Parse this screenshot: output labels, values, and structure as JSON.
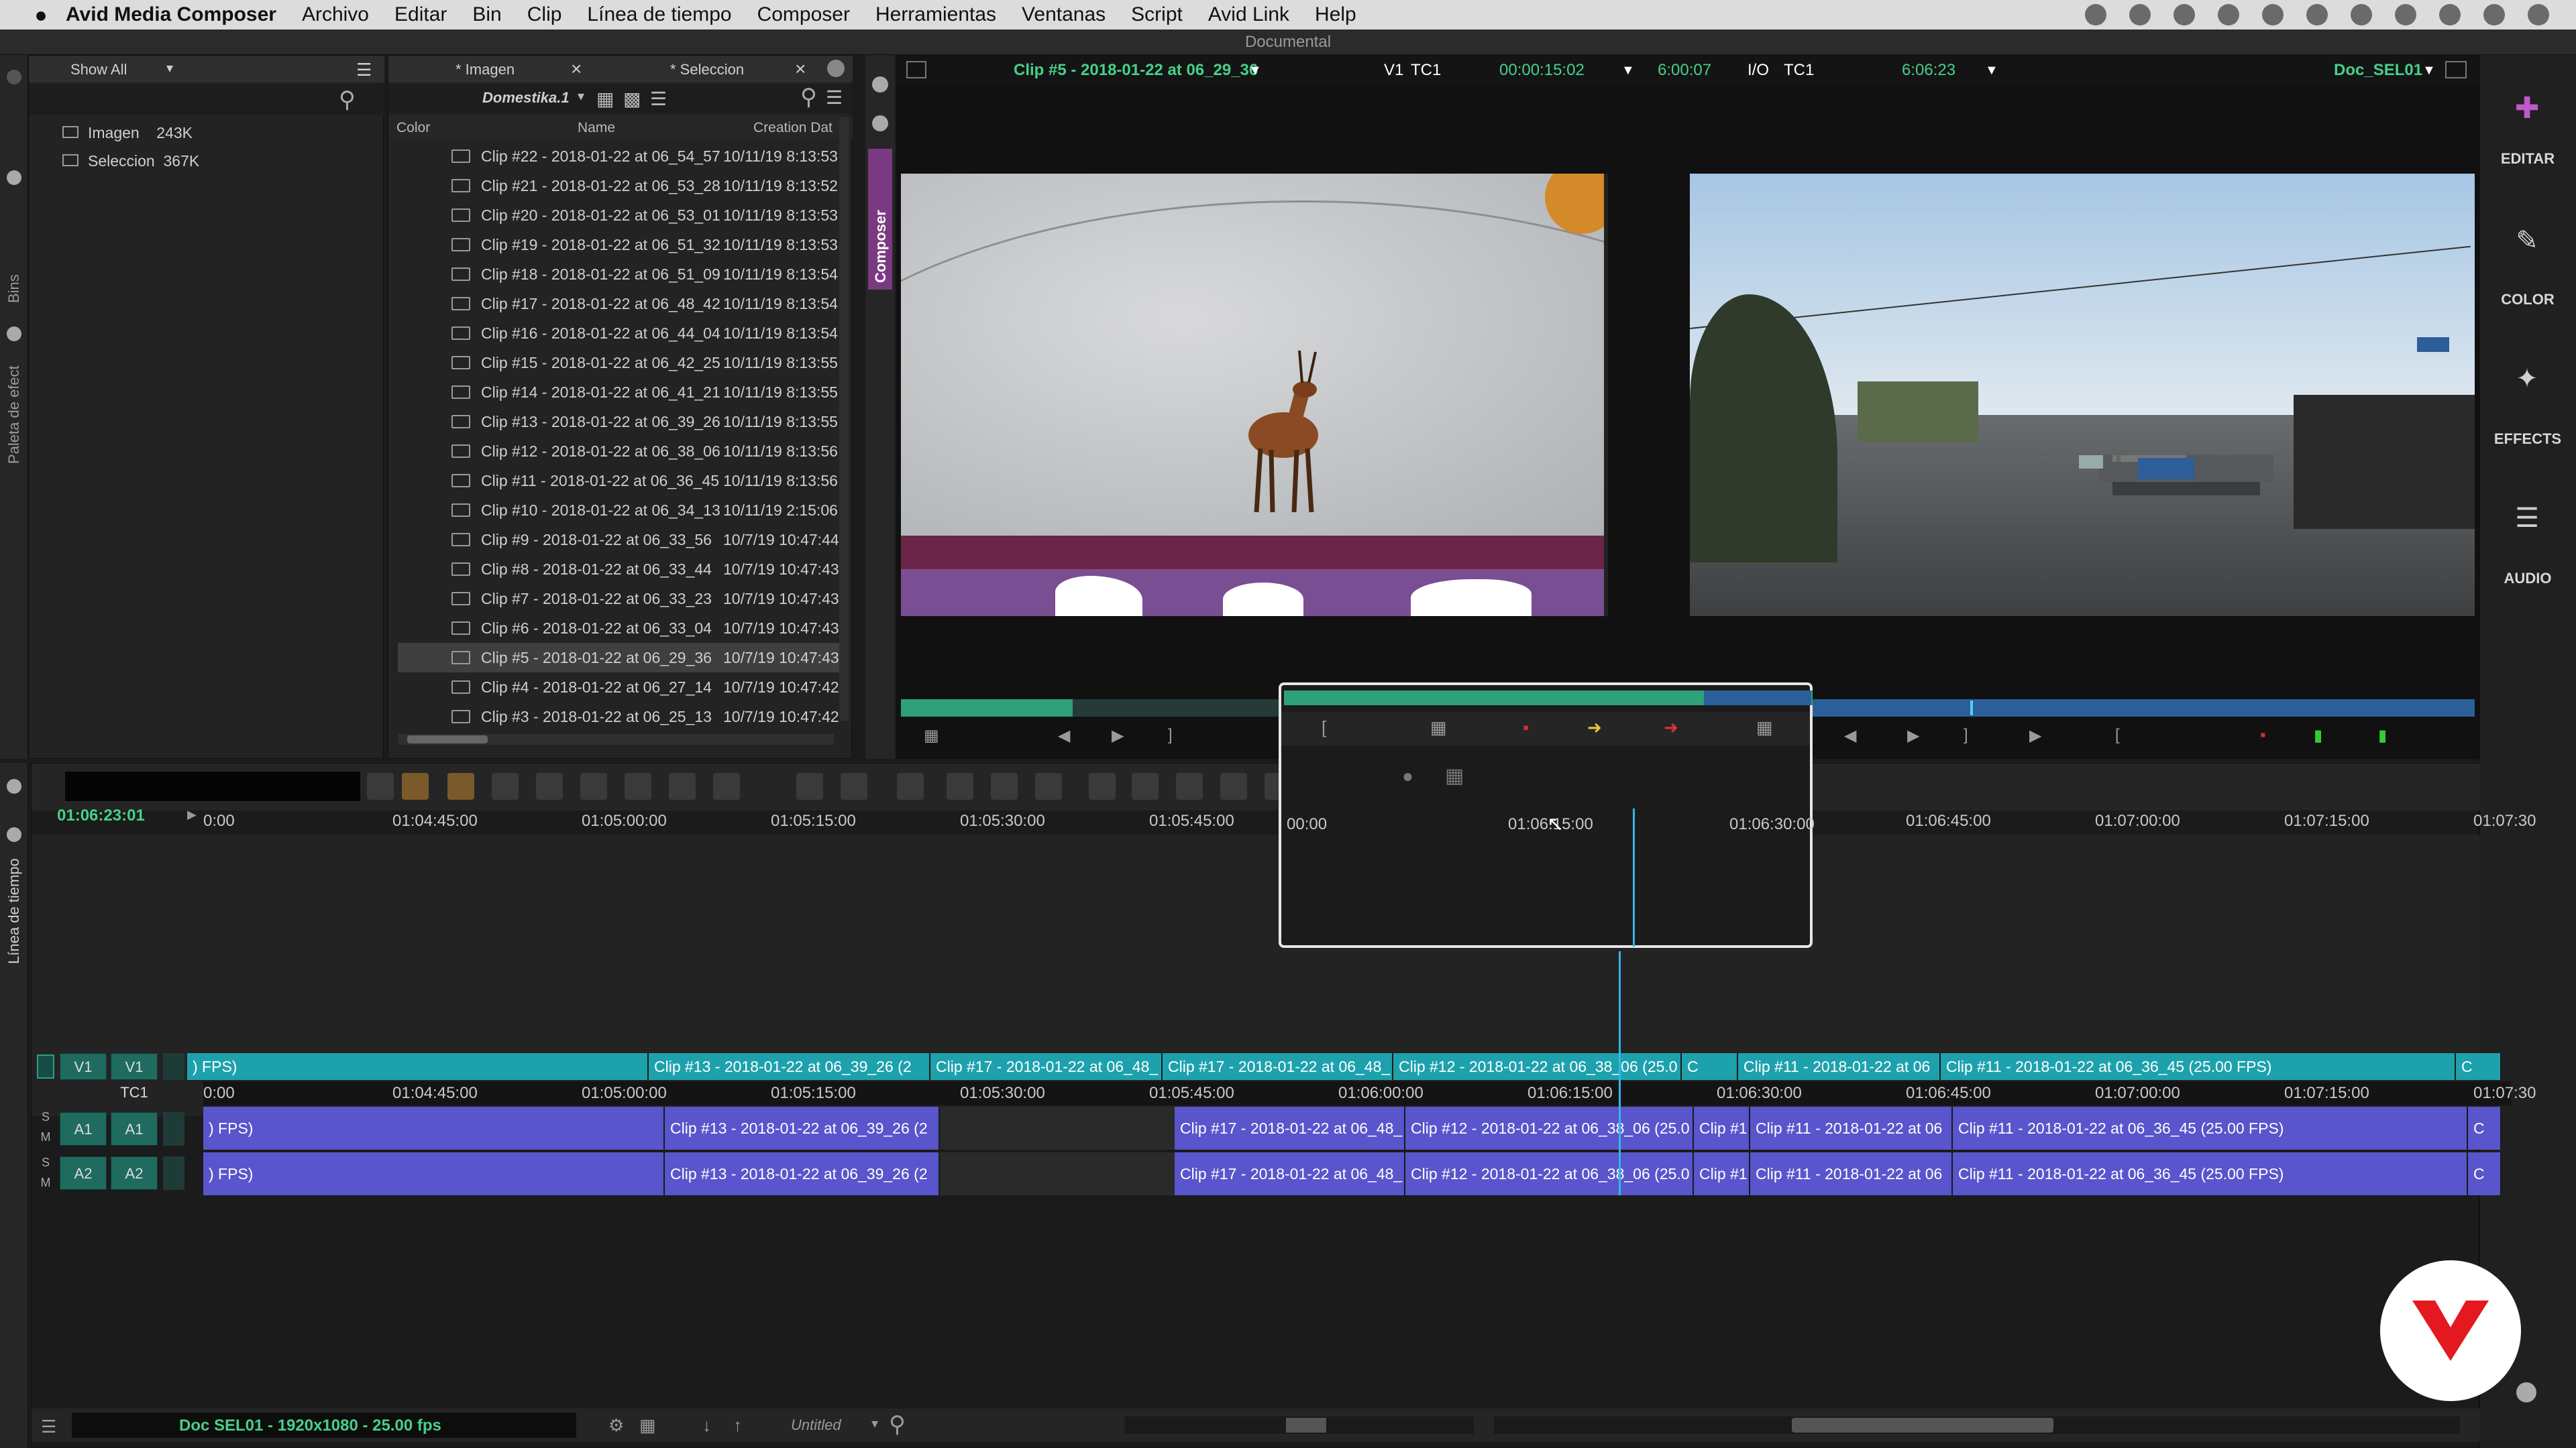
{
  "menubar": {
    "apple": "",
    "app": "Avid Media Composer",
    "items": [
      "Archivo",
      "Editar",
      "Bin",
      "Clip",
      "Línea de tiempo",
      "Composer",
      "Herramientas",
      "Ventanas",
      "Script",
      "Avid Link",
      "Help"
    ]
  },
  "window_title": "Documental",
  "bins_panel": {
    "filter": "Show All",
    "tab_label": "Bins",
    "effects_tab_label": "Paleta de efect",
    "bins": [
      {
        "name": "Imagen",
        "size": "243K"
      },
      {
        "name": "Seleccion",
        "size": "367K"
      }
    ]
  },
  "bin_tabs": {
    "tab1": "* Imagen",
    "tab2": "* Seleccion",
    "view": "Domestika.1",
    "columns": {
      "color": "Color",
      "name": "Name",
      "date": "Creation Dat"
    }
  },
  "clips": [
    {
      "name": "Clip #22 - 2018-01-22 at 06_54_57",
      "date": "10/11/19 8:13:53"
    },
    {
      "name": "Clip #21 - 2018-01-22 at 06_53_28",
      "date": "10/11/19 8:13:52"
    },
    {
      "name": "Clip #20 - 2018-01-22 at 06_53_01",
      "date": "10/11/19 8:13:53"
    },
    {
      "name": "Clip #19 - 2018-01-22 at 06_51_32",
      "date": "10/11/19 8:13:53"
    },
    {
      "name": "Clip #18 - 2018-01-22 at 06_51_09",
      "date": "10/11/19 8:13:54"
    },
    {
      "name": "Clip #17 - 2018-01-22 at 06_48_42",
      "date": "10/11/19 8:13:54"
    },
    {
      "name": "Clip #16 - 2018-01-22 at 06_44_04",
      "date": "10/11/19 8:13:54"
    },
    {
      "name": "Clip #15 - 2018-01-22 at 06_42_25",
      "date": "10/11/19 8:13:55"
    },
    {
      "name": "Clip #14 - 2018-01-22 at 06_41_21",
      "date": "10/11/19 8:13:55"
    },
    {
      "name": "Clip #13 - 2018-01-22 at 06_39_26",
      "date": "10/11/19 8:13:55"
    },
    {
      "name": "Clip #12 - 2018-01-22 at 06_38_06",
      "date": "10/11/19 8:13:56"
    },
    {
      "name": "Clip #11 - 2018-01-22 at 06_36_45",
      "date": "10/11/19 8:13:56"
    },
    {
      "name": "Clip #10 - 2018-01-22 at 06_34_13",
      "date": "10/11/19 2:15:06"
    },
    {
      "name": "Clip #9 - 2018-01-22 at 06_33_56",
      "date": "10/7/19 10:47:44"
    },
    {
      "name": "Clip #8 - 2018-01-22 at 06_33_44",
      "date": "10/7/19 10:47:43"
    },
    {
      "name": "Clip #7 - 2018-01-22 at 06_33_23",
      "date": "10/7/19 10:47:43"
    },
    {
      "name": "Clip #6 - 2018-01-22 at 06_33_04",
      "date": "10/7/19 10:47:43"
    },
    {
      "name": "Clip #5 - 2018-01-22 at 06_29_36",
      "date": "10/7/19 10:47:43"
    },
    {
      "name": "Clip #4 - 2018-01-22 at 06_27_14",
      "date": "10/7/19 10:47:42"
    },
    {
      "name": "Clip #3 - 2018-01-22 at 06_25_13",
      "date": "10/7/19 10:47:42"
    }
  ],
  "composer": {
    "tab_label": "Composer",
    "source_clip": "Clip #5 - 2018-01-22 at 06_29_36",
    "track": "V1",
    "tc_type": "TC1",
    "tc_value": "00:00:15:02",
    "duration": "6:00:07",
    "io_label": "I/O",
    "io_tc": "TC1",
    "io_value": "6:06:23",
    "sequence": "Doc_SEL01"
  },
  "right_rail": [
    "EDITAR",
    "COLOR",
    "EFFECTS",
    "AUDIO"
  ],
  "timeline": {
    "tab_label": "Línea de tiempo",
    "position": "01:06:23:01",
    "ruler": [
      "0:00",
      "01:04:45:00",
      "01:05:00:00",
      "01:05:15:00",
      "01:05:30:00",
      "01:05:45:00",
      "01:06:00:00",
      "01:06:15:00",
      "01:06:30:00",
      "01:06:45:00",
      "01:07:00:00",
      "01:07:15:00",
      "01:07:30"
    ],
    "zoom_ruler": [
      "00:00",
      "01:06:15:00",
      "01:06:30:00"
    ],
    "tracks": {
      "v1": "V1",
      "tc1": "TC1",
      "a1": "A1",
      "a2": "A2",
      "s": "S",
      "m": "M"
    },
    "v1_clips": [
      ") FPS)",
      "Clip #13 - 2018-01-22 at 06_39_26 (2",
      "Clip #17 - 2018-01-22 at 06_48_",
      "Clip #17 - 2018-01-22 at 06_48_",
      "Clip #12 - 2018-01-22 at 06_38_06 (25.0",
      "C",
      "Clip #11 - 2018-01-22 at 06",
      "Clip #11 - 2018-01-22 at 06_36_45 (25.00 FPS)",
      "C"
    ],
    "tc_ruler": [
      "0:00",
      "01:04:45:00",
      "01:05:00:00",
      "01:05:15:00",
      "01:05:30:00",
      "01:05:45:00",
      "01:06:00:00",
      "01:06:15:00",
      "01:06:30:00",
      "01:06:45:00",
      "01:07:00:00",
      "01:07:15:00",
      "01:07:30"
    ],
    "a_clips": [
      ") FPS)",
      "Clip #13 - 2018-01-22 at 06_39_26 (2",
      "",
      "Clip #17 - 2018-01-22 at 06_48_",
      "Clip #12 - 2018-01-22 at 06_38_06 (25.0",
      "Clip #1",
      "Clip #11 - 2018-01-22 at 06",
      "Clip #11 - 2018-01-22 at 06_36_45 (25.00 FPS)",
      "C"
    ],
    "status": "Doc SEL01 - 1920x1080 - 25.00 fps",
    "bin_name": "Untitled"
  },
  "colors": {
    "accent_green": "#46d08a",
    "video_track": "#1da2ad",
    "audio_track": "#5955cc",
    "logo_red": "#e3191f"
  }
}
